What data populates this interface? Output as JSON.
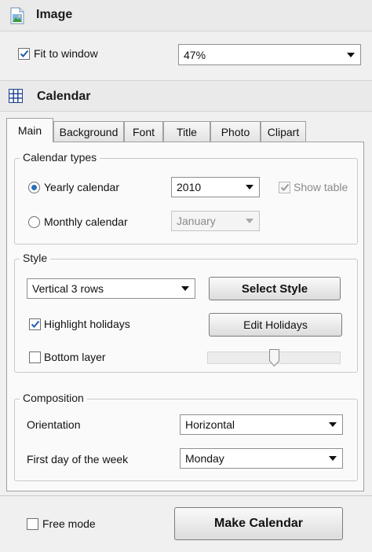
{
  "image_section": {
    "title": "Image",
    "icon": "image-icon",
    "fit_to_window_label": "Fit to window",
    "fit_to_window_checked": true,
    "zoom_value": "47%"
  },
  "calendar_section": {
    "title": "Calendar",
    "icon": "calendar-grid-icon",
    "tabs": [
      {
        "label": "Main",
        "active": true
      },
      {
        "label": "Background",
        "active": false
      },
      {
        "label": "Font",
        "active": false
      },
      {
        "label": "Title",
        "active": false
      },
      {
        "label": "Photo",
        "active": false
      },
      {
        "label": "Clipart",
        "active": false
      }
    ],
    "calendar_types": {
      "legend": "Calendar types",
      "yearly_label": "Yearly calendar",
      "yearly_selected": true,
      "year_value": "2010",
      "show_table_label": "Show table",
      "show_table_checked": true,
      "monthly_label": "Monthly calendar",
      "month_value": "January"
    },
    "style": {
      "legend": "Style",
      "style_value": "Vertical 3 rows",
      "select_style_label": "Select Style",
      "highlight_holidays_label": "Highlight holidays",
      "highlight_holidays_checked": true,
      "edit_holidays_label": "Edit Holidays",
      "bottom_layer_label": "Bottom layer",
      "bottom_layer_checked": false,
      "bottom_layer_slider_fraction": 0.5
    },
    "composition": {
      "legend": "Composition",
      "orientation_label": "Orientation",
      "orientation_value": "Horizontal",
      "first_day_label": "First day of the week",
      "first_day_value": "Monday"
    }
  },
  "footer": {
    "free_mode_label": "Free mode",
    "free_mode_checked": false,
    "make_calendar_label": "Make Calendar"
  },
  "colors": {
    "accent_blue": "#2b6fb8",
    "check_blue": "#1f5fae",
    "panel_bg": "#f0f0f0",
    "tab_panel_bg": "#fafafa"
  }
}
